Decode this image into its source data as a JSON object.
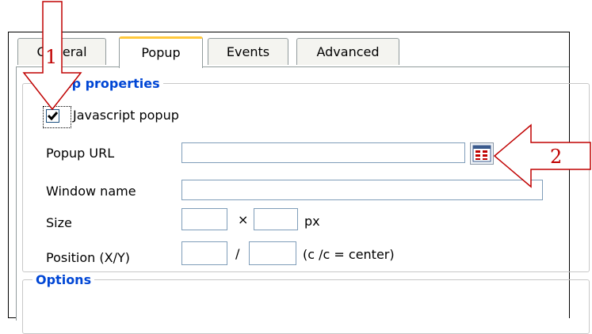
{
  "tabs": [
    "General",
    "Popup",
    "Events",
    "Advanced"
  ],
  "popup_properties": {
    "legend": "Popup properties",
    "javascript_popup_label": "Javascript popup",
    "javascript_popup_checked": true,
    "popup_url_label": "Popup URL",
    "popup_url_value": "",
    "window_name_label": "Window name",
    "window_name_value": "",
    "size_label": "Size",
    "size_x": "",
    "size_separator": "×",
    "size_y": "",
    "size_unit": "px",
    "position_label": "Position (X/Y)",
    "position_x": "",
    "position_separator": "/",
    "position_y": "",
    "position_hint": "(c /c = center)"
  },
  "options": {
    "legend": "Options"
  },
  "annotations": {
    "arrow1_number": "1",
    "arrow2_number": "2",
    "arrow_color": "#c00000"
  },
  "colors": {
    "legend_blue": "#0046d5",
    "tab_accent": "#ffc83c"
  }
}
